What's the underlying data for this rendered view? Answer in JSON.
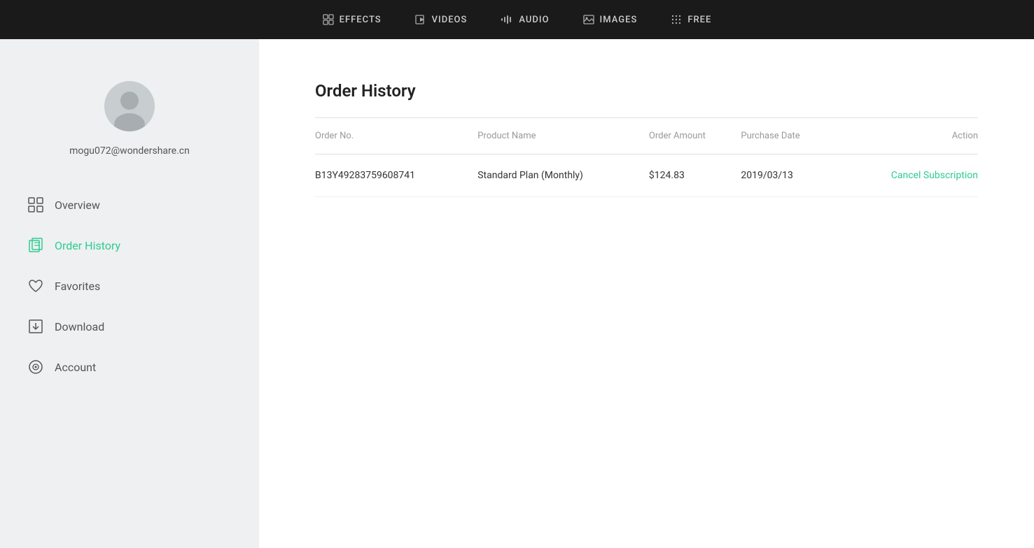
{
  "nav": {
    "items": [
      {
        "id": "effects",
        "label": "EFFECTS",
        "icon": "effects"
      },
      {
        "id": "videos",
        "label": "VIDEOS",
        "icon": "videos"
      },
      {
        "id": "audio",
        "label": "AUDIO",
        "icon": "audio"
      },
      {
        "id": "images",
        "label": "IMAGES",
        "icon": "images"
      },
      {
        "id": "free",
        "label": "FREE",
        "icon": "free"
      }
    ]
  },
  "sidebar": {
    "email": "mogu072@wondershare.cn",
    "menu": [
      {
        "id": "overview",
        "label": "Overview",
        "active": false
      },
      {
        "id": "order-history",
        "label": "Order History",
        "active": true
      },
      {
        "id": "favorites",
        "label": "Favorites",
        "active": false
      },
      {
        "id": "download",
        "label": "Download",
        "active": false
      },
      {
        "id": "account",
        "label": "Account",
        "active": false
      }
    ]
  },
  "content": {
    "title": "Order History",
    "table": {
      "headers": [
        "Order No.",
        "Product Name",
        "Order Amount",
        "Purchase Date",
        "Action"
      ],
      "rows": [
        {
          "order_no": "B13Y49283759608741",
          "product_name": "Standard Plan (Monthly)",
          "order_amount": "$124.83",
          "purchase_date": "2019/03/13",
          "action": "Cancel Subscription"
        }
      ]
    }
  },
  "colors": {
    "accent": "#2dcc8f",
    "nav_bg": "#1a1a1a"
  }
}
